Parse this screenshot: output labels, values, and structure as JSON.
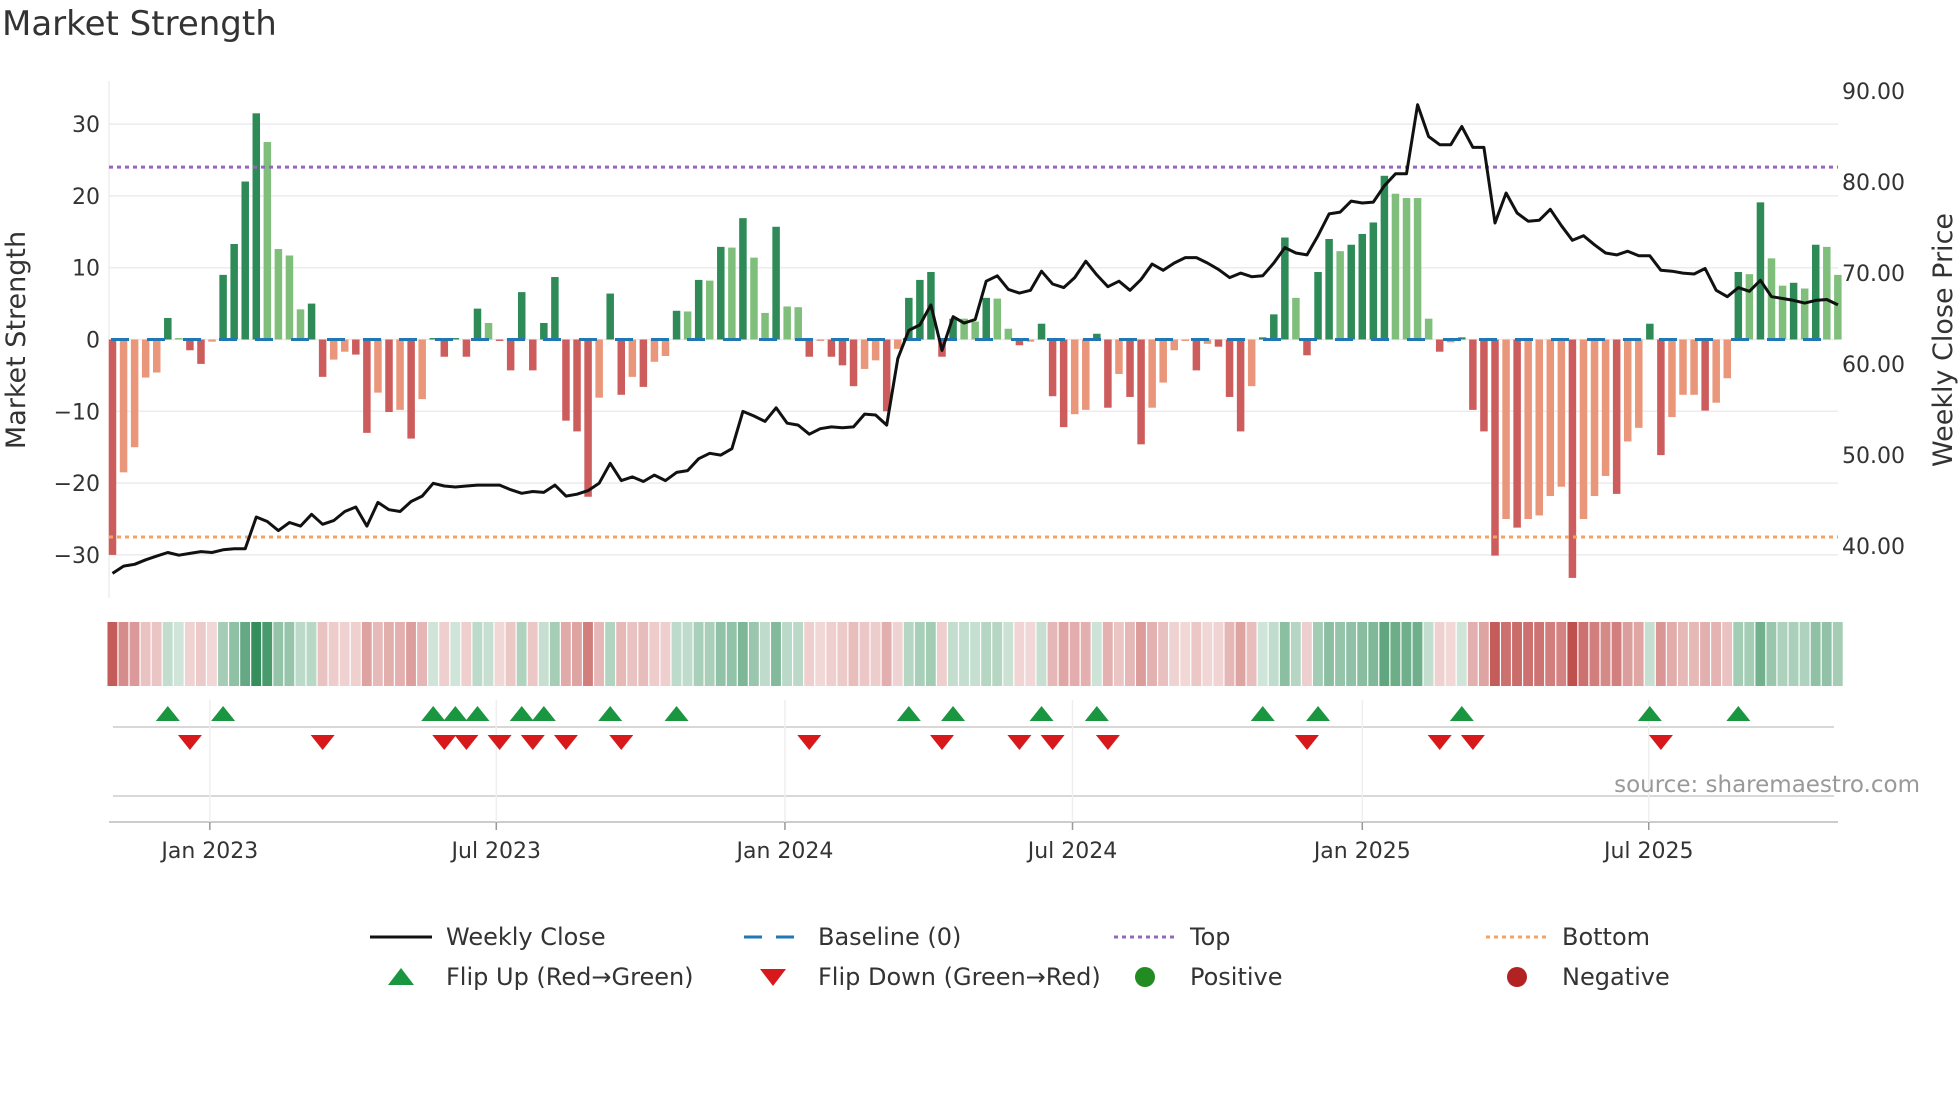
{
  "chart_data": {
    "type": "bar",
    "title": "Market Strength",
    "ylabel": "Market Strength",
    "y2label": "Weekly Close Price",
    "ylim": [
      -36,
      36
    ],
    "y2lim": [
      34.3,
      91.1
    ],
    "yticks": [
      -30,
      -20,
      -10,
      0,
      10,
      20,
      30
    ],
    "y2ticks": [
      "40.00",
      "50.00",
      "60.00",
      "70.00",
      "80.00",
      "90.00"
    ],
    "grid": true,
    "top_level": 24,
    "bottom_level": -27.5,
    "x_ticks": [
      {
        "label": "Jan 2023",
        "week": 8.8
      },
      {
        "label": "Jul 2023",
        "week": 34.7
      },
      {
        "label": "Jan 2024",
        "week": 60.8
      },
      {
        "label": "Jul 2024",
        "week": 86.8
      },
      {
        "label": "Jan 2025",
        "week": 113
      },
      {
        "label": "Jul 2025",
        "week": 138.9
      }
    ],
    "strength": [
      -30,
      -18.5,
      -15,
      -5.3,
      -4.6,
      3,
      0.2,
      -1.5,
      -3.4,
      -0.3,
      9,
      13.3,
      22,
      31.5,
      27.5,
      12.6,
      11.7,
      4.2,
      5,
      -5.2,
      -2.8,
      -1.7,
      -2.1,
      -13,
      -7.4,
      -10.1,
      -9.8,
      -13.8,
      -8.3,
      0.2,
      -2.4,
      0.2,
      -2.4,
      4.3,
      2.3,
      -0.2,
      -4.3,
      6.6,
      -4.3,
      2.3,
      8.7,
      -11.3,
      -12.8,
      -21.9,
      -8.1,
      6.4,
      -7.7,
      -5.2,
      -6.6,
      -3.1,
      -2.3,
      4,
      3.9,
      8.3,
      8.2,
      12.9,
      12.8,
      16.9,
      11.4,
      3.7,
      15.7,
      4.6,
      4.5,
      -2.4,
      -0.2,
      -2.4,
      -3.6,
      -6.5,
      -4.1,
      -2.9,
      -10,
      -1.3,
      5.8,
      8.3,
      9.4,
      -2.4,
      2.9,
      2.9,
      2.5,
      5.8,
      5.7,
      1.5,
      -0.8,
      -0.3,
      2.2,
      -7.9,
      -12.2,
      -10.4,
      -9.8,
      0.8,
      -9.5,
      -4.8,
      -8,
      -14.6,
      -9.5,
      -6,
      -1.5,
      -0.2,
      -4.3,
      -0.6,
      -1,
      -8,
      -12.8,
      -6.5,
      0.3,
      3.5,
      14.2,
      5.8,
      -2.2,
      9.4,
      14,
      12.3,
      13.2,
      14.7,
      16.3,
      22.8,
      20.3,
      19.7,
      19.7,
      2.9,
      -1.7,
      -0.4,
      0.3,
      -9.8,
      -12.8,
      -30.1,
      -25,
      -26.2,
      -25,
      -24.5,
      -21.8,
      -20.5,
      -33.2,
      -25,
      -21.8,
      -19,
      -21.5,
      -14.2,
      -12.3,
      2.2,
      -16.1,
      -10.8,
      -7.7,
      -7.7,
      -9.9,
      -8.8,
      -5.4,
      9.4,
      9.1,
      19.1,
      11.3,
      7.5,
      7.9,
      7.1,
      13.2,
      12.9,
      9
    ],
    "weekly_close": [
      37.0,
      37.8,
      38.0,
      38.5,
      38.9,
      39.3,
      39.0,
      39.2,
      39.4,
      39.3,
      39.6,
      39.7,
      39.7,
      43.2,
      42.7,
      41.7,
      42.6,
      42.2,
      43.5,
      42.4,
      42.8,
      43.8,
      44.3,
      42.2,
      44.8,
      44.0,
      43.8,
      44.9,
      45.5,
      46.9,
      46.6,
      46.5,
      46.6,
      46.7,
      46.7,
      46.7,
      46.2,
      45.8,
      46.0,
      45.9,
      46.7,
      45.5,
      45.7,
      46.1,
      46.9,
      49.1,
      47.2,
      47.6,
      47.1,
      47.8,
      47.2,
      48.1,
      48.3,
      49.6,
      50.2,
      50.0,
      50.7,
      54.8,
      54.3,
      53.7,
      55.2,
      53.5,
      53.3,
      52.3,
      52.9,
      53.1,
      53.0,
      53.1,
      54.5,
      54.4,
      53.3,
      60.6,
      63.7,
      64.3,
      66.5,
      61.5,
      65.2,
      64.5,
      64.9,
      69.1,
      69.7,
      68.2,
      67.8,
      68.1,
      70.2,
      68.8,
      68.4,
      69.5,
      71.3,
      69.8,
      68.5,
      69.1,
      68.1,
      69.3,
      71.0,
      70.3,
      71.1,
      71.7,
      71.7,
      71.1,
      70.4,
      69.5,
      70.0,
      69.6,
      69.7,
      71.1,
      72.8,
      72.2,
      72.0,
      74.1,
      76.5,
      76.7,
      77.9,
      77.7,
      77.8,
      79.6,
      80.9,
      80.9,
      88.5,
      85.0,
      84.1,
      84.1,
      86.1,
      83.8,
      83.8,
      75.5,
      78.8,
      76.6,
      75.7,
      75.8,
      77.0,
      75.2,
      73.6,
      74.1,
      73.1,
      72.2,
      72.0,
      72.4,
      71.9,
      71.9,
      70.3,
      70.2,
      70.0,
      69.9,
      70.5,
      68.1,
      67.4,
      68.4,
      68.0,
      69.2,
      67.4,
      67.2,
      67.0,
      66.7,
      67.0,
      67.1,
      66.5
    ],
    "flip_up_weeks": [
      5,
      10,
      29,
      31,
      33,
      37,
      39,
      45,
      51,
      72,
      76,
      84,
      89,
      104,
      109,
      122,
      139,
      147
    ],
    "flip_down_weeks": [
      7,
      19,
      30,
      32,
      35,
      38,
      41,
      46,
      63,
      75,
      82,
      85,
      90,
      108,
      120,
      123,
      140
    ],
    "legend": [
      {
        "key": "weekly_close",
        "label": "Weekly Close"
      },
      {
        "key": "baseline",
        "label": "Baseline (0)"
      },
      {
        "key": "top",
        "label": "Top"
      },
      {
        "key": "bottom",
        "label": "Bottom"
      },
      {
        "key": "flip_up",
        "label": "Flip Up (Red→Green)"
      },
      {
        "key": "flip_down",
        "label": "Flip Down (Green→Red)"
      },
      {
        "key": "positive",
        "label": "Positive"
      },
      {
        "key": "negative",
        "label": "Negative"
      }
    ],
    "source": "source: sharemaestro.com"
  },
  "colors": {
    "green_dark": "#2e8b57",
    "green_light": "#7fbf7b",
    "red_dark": "#cd5c5c",
    "red_light": "#e9967a",
    "baseline": "#1f77b4",
    "top": "#9467bd",
    "bottom": "#f4a460",
    "line": "#111111",
    "flip_up": "#1a9641",
    "flip_down": "#d7191c",
    "positive": "#228b22",
    "negative": "#b22222"
  }
}
